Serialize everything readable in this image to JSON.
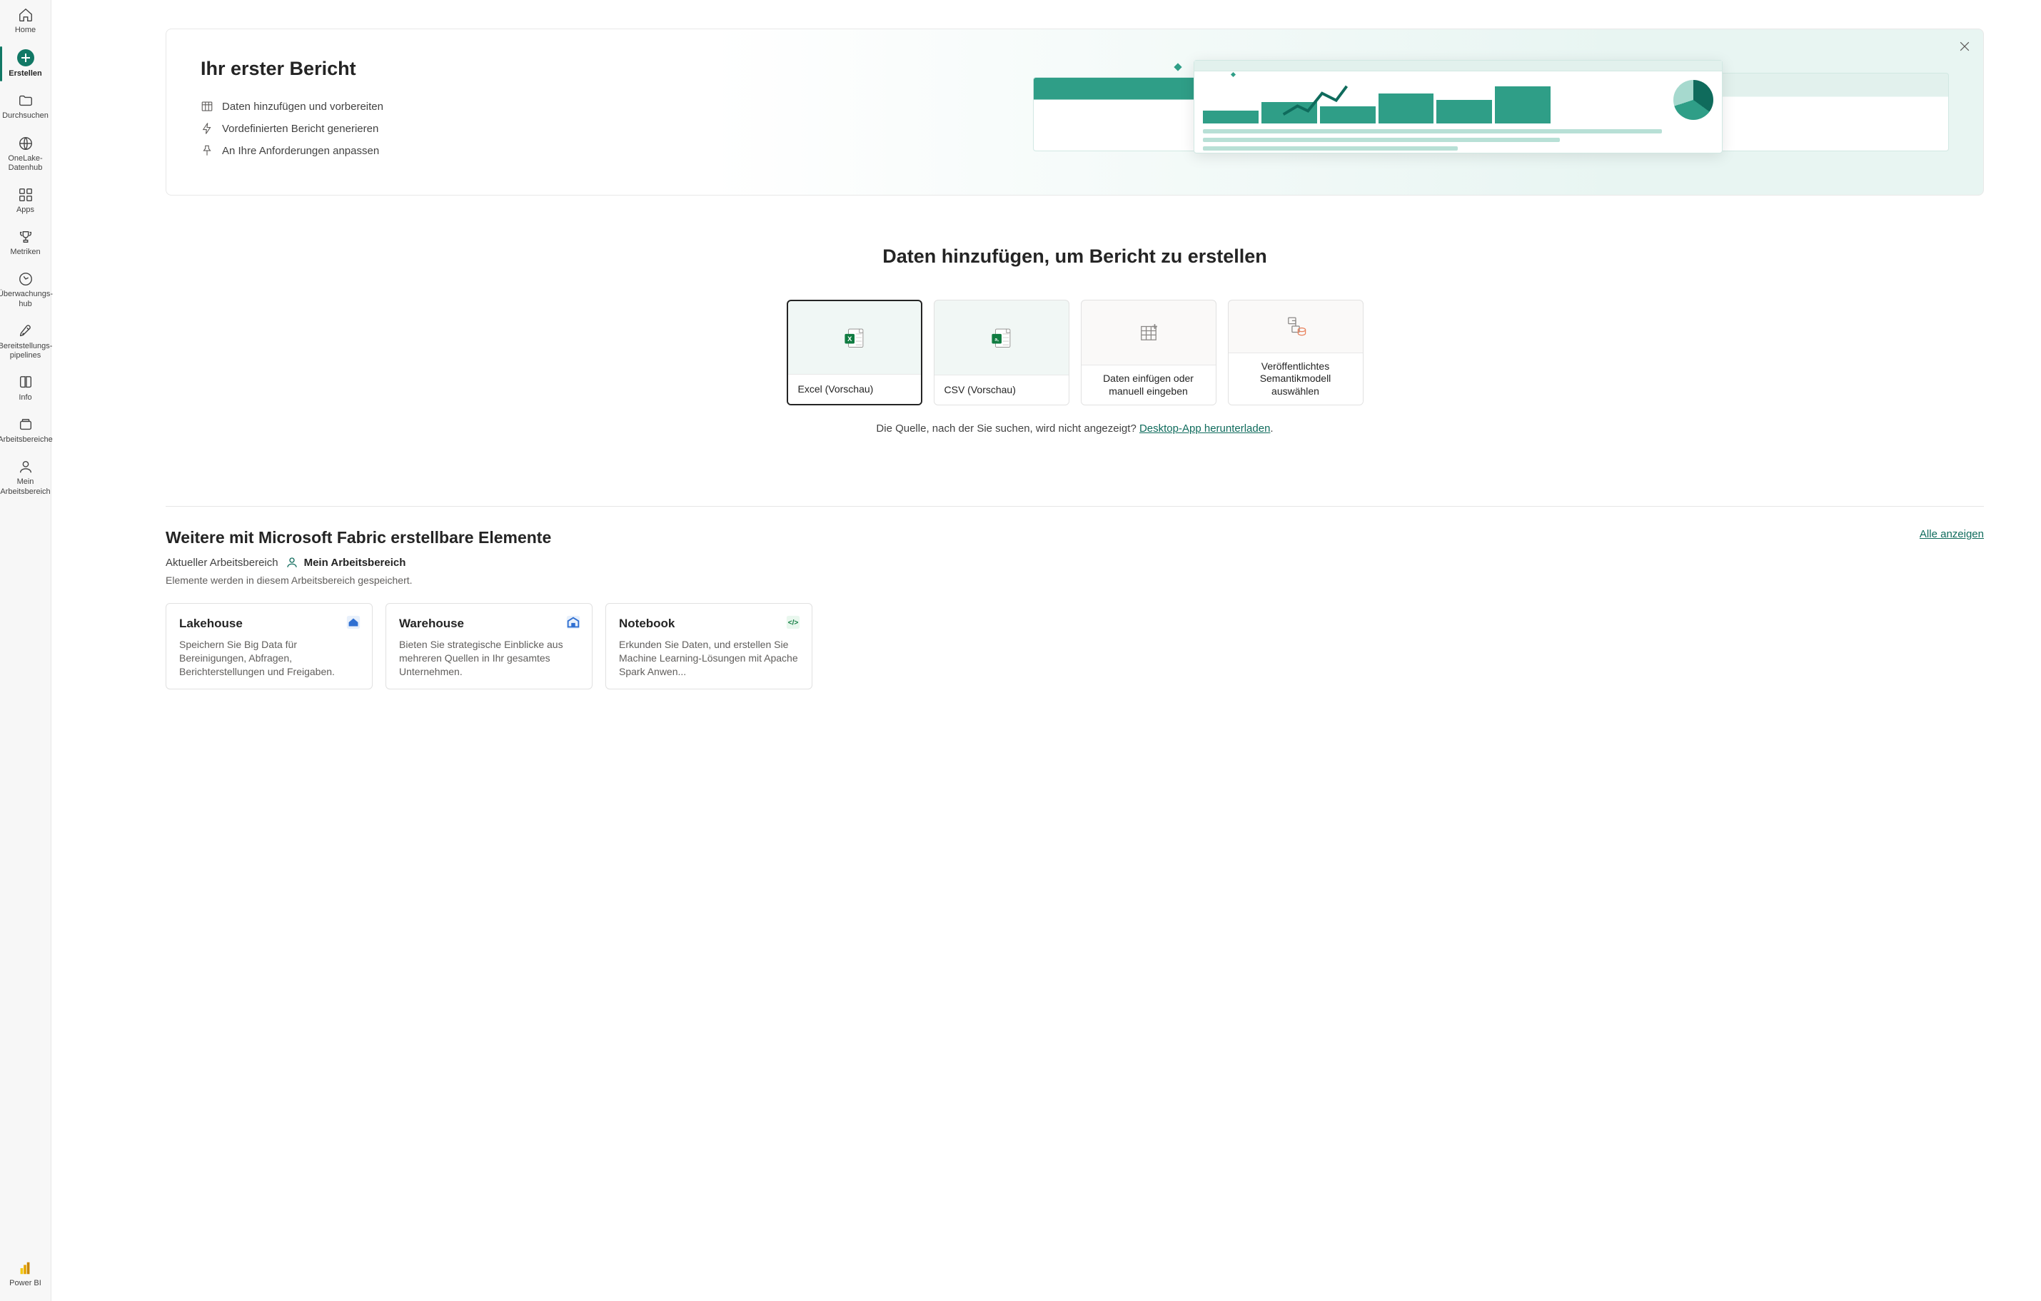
{
  "rail": {
    "items": [
      {
        "label": "Home"
      },
      {
        "label": "Erstellen"
      },
      {
        "label": "Durchsuchen"
      },
      {
        "label": "OneLake-Datenhub"
      },
      {
        "label": "Apps"
      },
      {
        "label": "Metriken"
      },
      {
        "label": "Überwachungs-hub"
      },
      {
        "label": "Bereitstellungs-pipelines"
      },
      {
        "label": "Info"
      },
      {
        "label": "Arbeitsbereiche"
      },
      {
        "label": "Mein Arbeitsbereich"
      }
    ],
    "footer": {
      "label": "Power BI"
    }
  },
  "hero": {
    "title": "Ihr erster Bericht",
    "bullets": [
      "Daten hinzufügen und vorbereiten",
      "Vordefinierten Bericht generieren",
      "An Ihre Anforderungen anpassen"
    ]
  },
  "addData": {
    "heading": "Daten hinzufügen, um Bericht zu erstellen",
    "cards": [
      {
        "label": "Excel (Vorschau)"
      },
      {
        "label": "CSV (Vorschau)"
      },
      {
        "label": "Daten einfügen oder manuell eingeben"
      },
      {
        "label": "Veröffentlichtes Semantikmodell auswählen"
      }
    ],
    "hintPrefix": "Die Quelle, nach der Sie suchen, wird nicht angezeigt? ",
    "hintLink": "Desktop-App herunterladen",
    "hintSuffix": "."
  },
  "fabric": {
    "heading": "Weitere mit Microsoft Fabric erstellbare Elemente",
    "showAll": "Alle anzeigen",
    "workspaceLabel": "Aktueller Arbeitsbereich",
    "workspaceName": "Mein Arbeitsbereich",
    "note": "Elemente werden in diesem Arbeitsbereich gespeichert.",
    "cards": [
      {
        "title": "Lakehouse",
        "desc": "Speichern Sie Big Data für Bereinigungen, Abfragen, Berichterstellungen und Freigaben."
      },
      {
        "title": "Warehouse",
        "desc": "Bieten Sie strategische Einblicke aus mehreren Quellen in Ihr gesamtes Unternehmen."
      },
      {
        "title": "Notebook",
        "desc": "Erkunden Sie Daten, und erstellen Sie Machine Learning-Lösungen mit Apache Spark Anwen..."
      }
    ]
  }
}
